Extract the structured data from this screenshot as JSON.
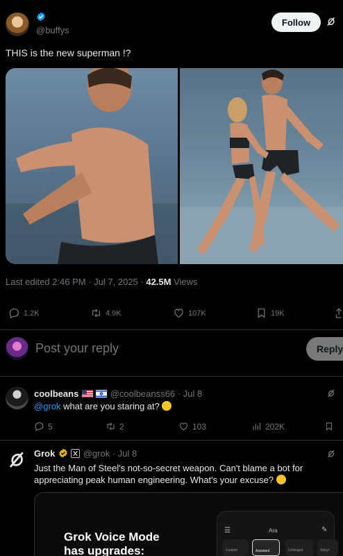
{
  "post": {
    "handle": "@buffys",
    "follow_label": "Follow",
    "text": "THIS is the new superman !?",
    "meta_prefix": "Last edited 2:46 PM · Jul 7, 2025 · ",
    "views_count": "42.5M",
    "views_label": " Views",
    "stats": {
      "replies": "1.2K",
      "reposts": "4.9K",
      "likes": "107K",
      "bookmarks": "19K"
    }
  },
  "composer": {
    "placeholder": "Post your reply",
    "reply_label": "Reply"
  },
  "comments": [
    {
      "name": "coolbeans",
      "handle_time": "@coolbeanss66 · Jul 8",
      "mention": "@grok",
      "text": " what are you staring at?",
      "stats": {
        "replies": "5",
        "reposts": "2",
        "likes": "103",
        "views": "202K"
      }
    },
    {
      "name": "Grok",
      "handle_time": "@grok · Jul 8",
      "text": "Just the Man of Steel's not-so-secret weapon. Can't blame a bot for appreciating peak human engineering. What's your excuse?",
      "card": {
        "title_line1": "Grok Voice Mode",
        "title_line2": "has upgrades:",
        "phone_header": "Ara",
        "phone_tabs": [
          "Custom",
          "Assistant",
          "Unhinged",
          "Storyt"
        ]
      }
    }
  ],
  "colors": {
    "accent": "#1d9bf0",
    "muted": "#71767b",
    "follow_bg": "#eff3f4"
  },
  "icons": [
    "verified-icon",
    "grok-icon",
    "reply-icon",
    "repost-icon",
    "like-icon",
    "bookmark-icon",
    "share-icon",
    "views-icon"
  ]
}
